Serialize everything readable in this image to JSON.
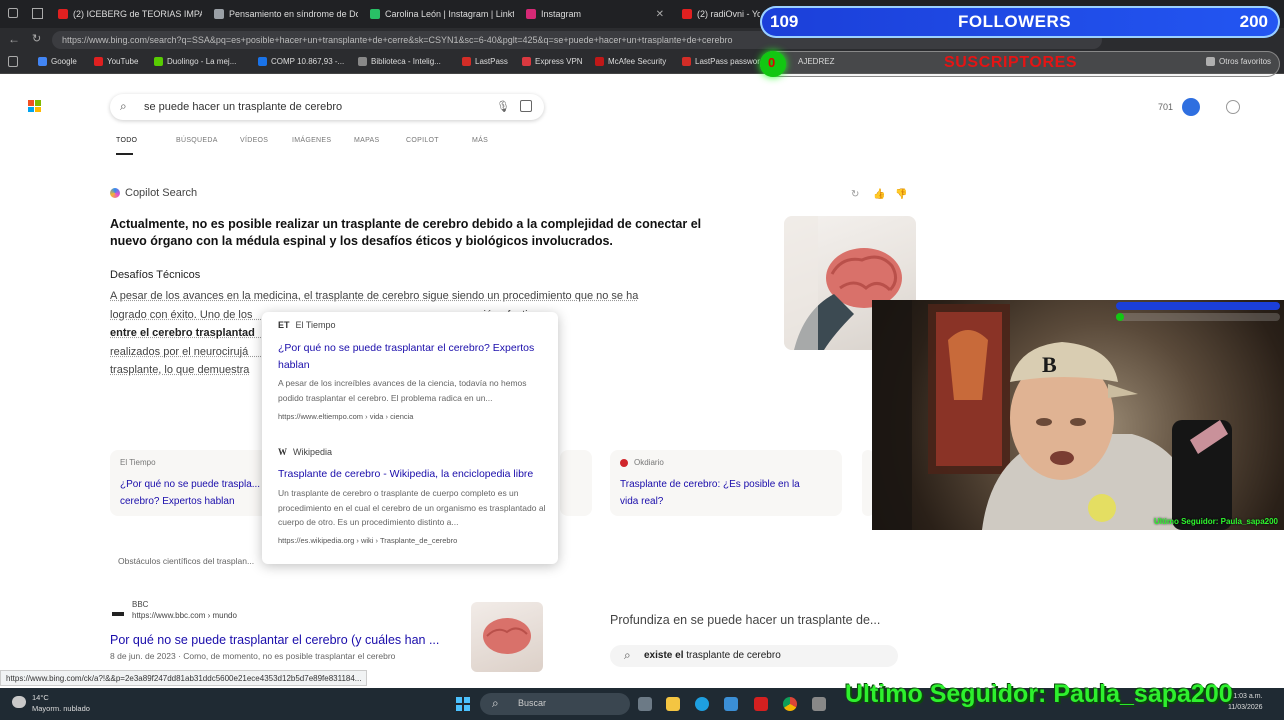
{
  "browser": {
    "tabs": [
      {
        "label": "(2) ICEBERG de TEORIAS IMPACT",
        "color": "#e02020"
      },
      {
        "label": "Pensamiento en síndrome de Do",
        "color": "#9aa0a6"
      },
      {
        "label": "Carolina León | Instagram | Linkt",
        "color": "#29c066"
      },
      {
        "label": "Instagram",
        "color": "#d62976"
      },
      {
        "label": "(2) radiOvni - YouTube",
        "color": "#e02020"
      }
    ],
    "url": "https://www.bing.com/search?q=SSA&pq=es+posible+hacer+un+transplante+de+cerre&sk=CSYN1&sc=6-40&pglt=425&q=se+puede+hacer+un+trasplante+de+cerebro",
    "bookmarks": [
      {
        "label": "Google",
        "color": "#4285f4"
      },
      {
        "label": "YouTube",
        "color": "#e02020"
      },
      {
        "label": "Duolingo - La mej...",
        "color": "#58cc02"
      },
      {
        "label": "COMP 10.867,93 -...",
        "color": "#1a73e8"
      },
      {
        "label": "Biblioteca - Intelig...",
        "color": "#888888"
      },
      {
        "label": "LastPass",
        "color": "#d32d27"
      },
      {
        "label": "Express VPN",
        "color": "#da3940"
      },
      {
        "label": "McAfee Security",
        "color": "#c01818"
      },
      {
        "label": "LastPass passwor...",
        "color": "#d32d27"
      },
      {
        "label": "AJEDREZ",
        "color": "#7fa650"
      },
      {
        "label": "Otros favoritos",
        "color": "#aaaaaa"
      }
    ]
  },
  "bing": {
    "query": "se puede hacer un trasplante de cerebro",
    "rewards": "701",
    "nav_tabs": [
      "TODO",
      "BÚSQUEDA",
      "VÍDEOS",
      "IMÁGENES",
      "MAPAS",
      "COPILOT",
      "MÁS"
    ],
    "copilot_label": "Copilot Search",
    "answer": "Actualmente, no es posible realizar un trasplante de cerebro debido a la complejidad de conectar el nuevo órgano con la médula espinal y los desafíos éticos y biológicos involucrados.",
    "subheading": "Desafíos Técnicos",
    "paragraph": [
      "A pesar de los avances en la medicina, el trasplante de cerebro sigue siendo un procedimiento que no se ha",
      "logrado con éxito. Uno de los                                                             na conexión efectiva",
      "entre el cerebro trasplantad                                                              tos, como los",
      "realizados por el neurocirujá                                                             paralizados tras el",
      "trasplante, lo que demuestra"
    ],
    "popup": [
      {
        "source": "El Tiempo",
        "source_badge": "ET",
        "title": "¿Por qué no se puede trasplantar el cerebro? Expertos hablan",
        "desc": "A pesar de los increíbles avances de la ciencia, todavía no hemos podido trasplantar el cerebro. El problema radica en un...",
        "url": "https://www.eltiempo.com › vida › ciencia"
      },
      {
        "source": "Wikipedia",
        "source_badge": "W",
        "title": "Trasplante de cerebro - Wikipedia, la enciclopedia libre",
        "desc": "Un trasplante de cerebro o trasplante de cuerpo completo es un procedimiento en el cual el cerebro de un organismo es trasplantado al cuerpo de otro. Es un procedimiento distinto a...",
        "url": "https://es.wikipedia.org › wiki › Trasplante_de_cerebro"
      }
    ],
    "cards": [
      {
        "source": "El Tiempo",
        "title": "¿Por qué no se puede traspla... cerebro? Expertos hablan"
      },
      {
        "source": "Okdiario",
        "title": "Trasplante de cerebro: ¿Es posible en la vida real?"
      }
    ],
    "obstacles": "Obstáculos científicos del trasplan...",
    "bbc": {
      "source": "BBC",
      "url": "https://www.bbc.com › mundo",
      "title": "Por qué no se puede trasplantar el cerebro (y cuáles han ...",
      "date": "8 de jun. de 2023 · Como, de momento, no es posible trasplantar el cerebro"
    },
    "deep_title": "Profundiza en se puede hacer un trasplante de...",
    "deep_query_bold": "existe el",
    "deep_query": " trasplante de cerebro",
    "status_url": "https://www.bing.com/ck/a?!&&p=2e3a89f247dd81ab31ddc5600e21ece4353d12b5d7e89fe831184..."
  },
  "taskbar": {
    "temp": "14°C",
    "weather": "Mayorm. nublado",
    "search_placeholder": "Buscar",
    "time": "11:03 a.m.",
    "date": "11/03/2026"
  },
  "overlay": {
    "followers_count": "109",
    "followers_label": "FOLLOWERS",
    "followers_goal": "200",
    "subs_count": "0",
    "subs_label": "SUSCRIPTORES",
    "cam_banner": "Ultimo Seguidor: Paula_sapa200",
    "last_follower": "Ultimo Seguidor: Paula_sapa200"
  }
}
